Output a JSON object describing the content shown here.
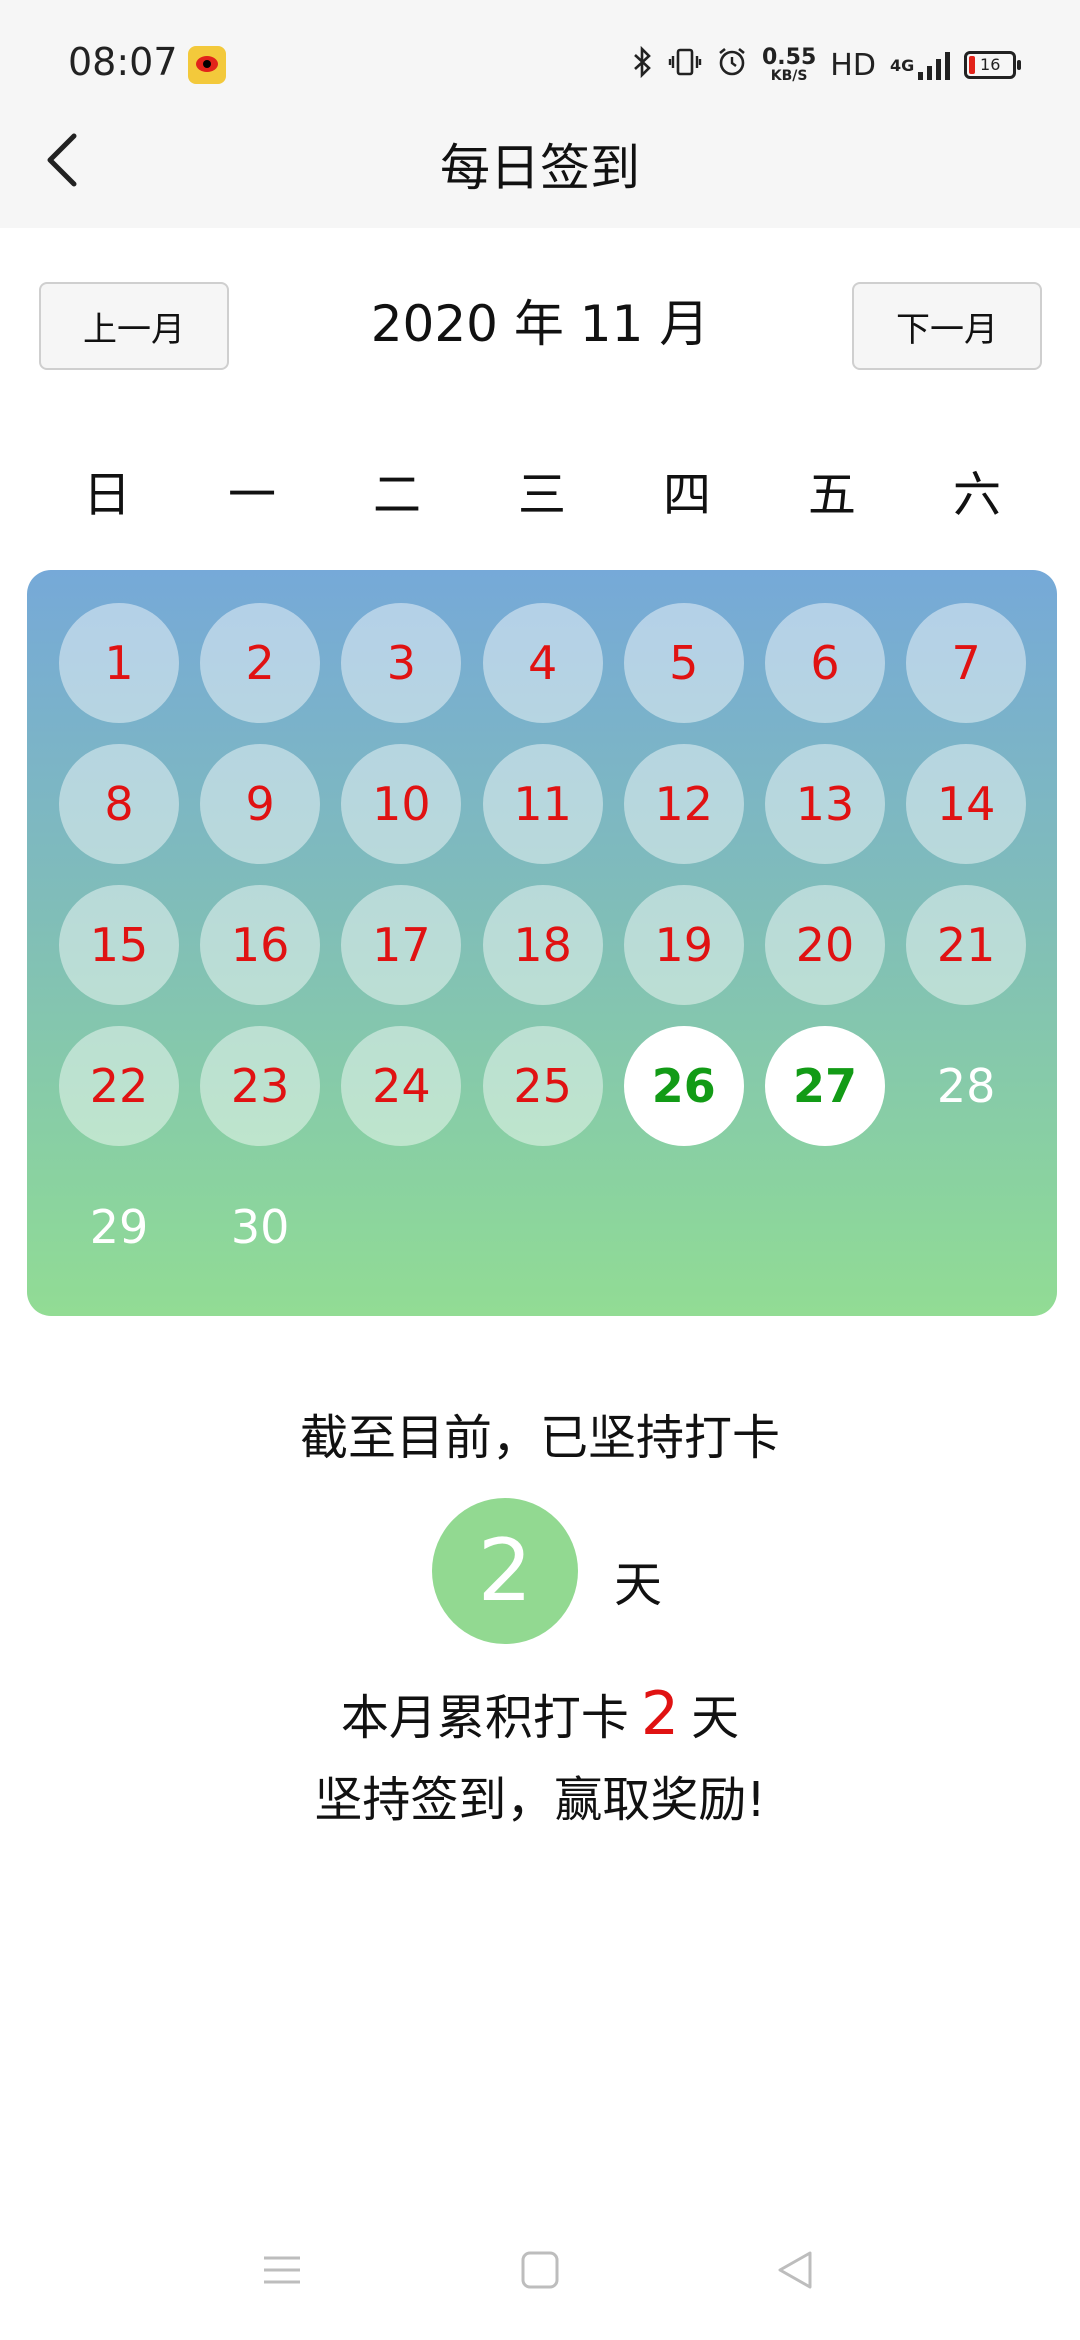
{
  "status_bar": {
    "time": "08:07",
    "speed_value": "0.55",
    "speed_unit": "KB/S",
    "hd": "HD",
    "network": "4G",
    "battery": "16"
  },
  "header": {
    "title": "每日签到"
  },
  "month_nav": {
    "prev_label": "上一月",
    "next_label": "下一月",
    "month_title": "2020 年 11 月"
  },
  "weekdays": [
    "日",
    "一",
    "二",
    "三",
    "四",
    "五",
    "六"
  ],
  "calendar": {
    "days": [
      {
        "d": "1",
        "state": "past"
      },
      {
        "d": "2",
        "state": "past"
      },
      {
        "d": "3",
        "state": "past"
      },
      {
        "d": "4",
        "state": "past"
      },
      {
        "d": "5",
        "state": "past"
      },
      {
        "d": "6",
        "state": "past"
      },
      {
        "d": "7",
        "state": "past"
      },
      {
        "d": "8",
        "state": "past"
      },
      {
        "d": "9",
        "state": "past"
      },
      {
        "d": "10",
        "state": "past"
      },
      {
        "d": "11",
        "state": "past"
      },
      {
        "d": "12",
        "state": "past"
      },
      {
        "d": "13",
        "state": "past"
      },
      {
        "d": "14",
        "state": "past"
      },
      {
        "d": "15",
        "state": "past"
      },
      {
        "d": "16",
        "state": "past"
      },
      {
        "d": "17",
        "state": "past"
      },
      {
        "d": "18",
        "state": "past"
      },
      {
        "d": "19",
        "state": "past"
      },
      {
        "d": "20",
        "state": "past"
      },
      {
        "d": "21",
        "state": "past"
      },
      {
        "d": "22",
        "state": "past"
      },
      {
        "d": "23",
        "state": "past"
      },
      {
        "d": "24",
        "state": "past"
      },
      {
        "d": "25",
        "state": "past"
      },
      {
        "d": "26",
        "state": "signed"
      },
      {
        "d": "27",
        "state": "signed"
      },
      {
        "d": "28",
        "state": "future"
      },
      {
        "d": "29",
        "state": "future"
      },
      {
        "d": "30",
        "state": "future"
      }
    ],
    "colors": {
      "missed_text": "#e01212",
      "signed_text": "#129b16",
      "future_text": "#ffffff"
    }
  },
  "summary": {
    "streak_label": "截至目前，已坚持打卡",
    "streak_days": "2",
    "streak_unit": "天",
    "month_total_prefix": "本月累积打卡",
    "month_total_value": "2",
    "month_total_suffix": "天",
    "encourage": "坚持签到，赢取奖励!"
  },
  "nav_bar": {
    "icons": [
      "menu-icon",
      "home-icon",
      "back-triangle-icon"
    ]
  }
}
